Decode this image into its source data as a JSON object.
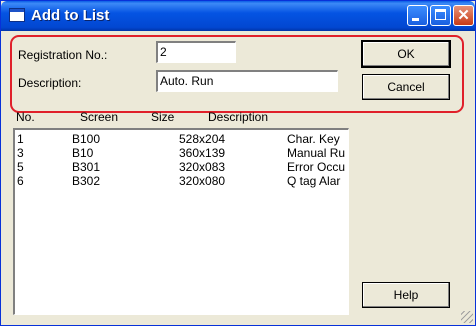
{
  "window": {
    "title": "Add to List"
  },
  "form": {
    "registration_label": "Registration No.:",
    "registration_value": "2",
    "description_label": "Description:",
    "description_value": "Auto. Run"
  },
  "buttons": {
    "ok": "OK",
    "cancel": "Cancel",
    "help": "Help"
  },
  "list": {
    "columns": [
      "No.",
      "Screen",
      "Size",
      "Description"
    ],
    "rows": [
      {
        "no": "1",
        "screen": "B100",
        "size": "528x204",
        "desc": "Char. Key"
      },
      {
        "no": "3",
        "screen": "B10",
        "size": "360x139",
        "desc": "Manual Ru"
      },
      {
        "no": "5",
        "screen": "B301",
        "size": "320x083",
        "desc": "Error Occu"
      },
      {
        "no": "6",
        "screen": "B302",
        "size": "320x080",
        "desc": "Q tag Alar"
      }
    ]
  },
  "colors": {
    "title_bar": "#0554e3",
    "highlight": "#e0202a",
    "dialog_bg": "#ece9d8"
  }
}
